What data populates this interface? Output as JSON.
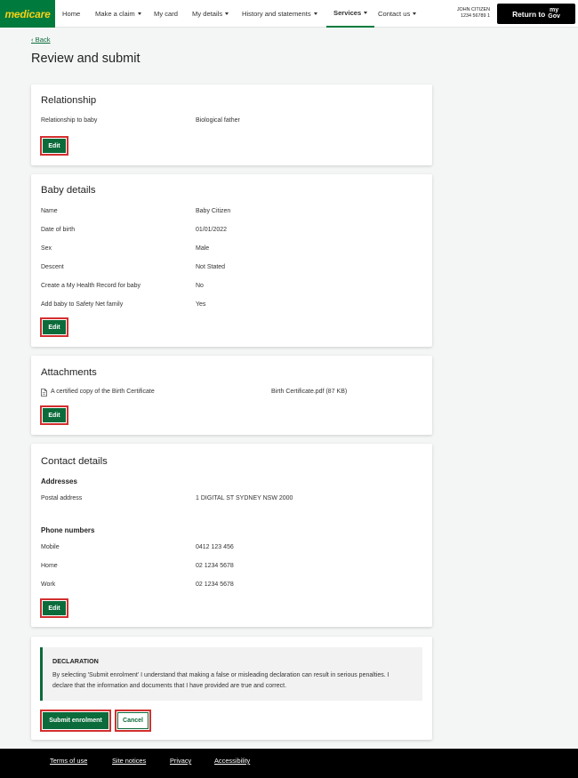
{
  "brand": {
    "logo_text": "medicare",
    "primary_color": "#007a3d",
    "logo_text_color": "#f7d117"
  },
  "nav": {
    "items": [
      {
        "label": "Home",
        "caret": false,
        "active": false
      },
      {
        "label": "Make a claim",
        "caret": true,
        "active": false
      },
      {
        "label": "My card",
        "caret": false,
        "active": false
      },
      {
        "label": "My details",
        "caret": true,
        "active": false
      },
      {
        "label": "History and statements",
        "caret": true,
        "active": false
      },
      {
        "label": "Services",
        "caret": true,
        "active": true
      },
      {
        "label": "Contact us",
        "caret": true,
        "active": false
      }
    ],
    "user_name": "JOHN CITIZEN",
    "user_number": "1234 56789 1",
    "return_label": "Return to",
    "mygov_line1": "my",
    "mygov_line2": "Gov"
  },
  "page": {
    "back_label": "Back",
    "title": "Review and submit"
  },
  "relationship": {
    "title": "Relationship",
    "rows": [
      {
        "label": "Relationship to baby",
        "value": "Biological father"
      }
    ],
    "edit_label": "Edit"
  },
  "baby_details": {
    "title": "Baby details",
    "rows": [
      {
        "label": "Name",
        "value": "Baby Citizen"
      },
      {
        "label": "Date of birth",
        "value": "01/01/2022"
      },
      {
        "label": "Sex",
        "value": "Male"
      },
      {
        "label": "Descent",
        "value": "Not Stated"
      },
      {
        "label": "Create a My Health Record for baby",
        "value": "No"
      },
      {
        "label": "Add baby to Safety Net family",
        "value": "Yes"
      }
    ],
    "edit_label": "Edit"
  },
  "attachments": {
    "title": "Attachments",
    "item_label": "A certified copy of the Birth Certificate",
    "item_value": "Birth Certificate.pdf (87 KB)",
    "edit_label": "Edit"
  },
  "contact_details": {
    "title": "Contact details",
    "addresses_heading": "Addresses",
    "postal_label": "Postal address",
    "postal_value": "1 DIGITAL ST SYDNEY NSW 2000",
    "phones_heading": "Phone numbers",
    "phones": [
      {
        "label": "Mobile",
        "value": "0412 123 456"
      },
      {
        "label": "Home",
        "value": "02 1234 5678"
      },
      {
        "label": "Work",
        "value": "02 1234 5678"
      }
    ],
    "edit_label": "Edit"
  },
  "declaration": {
    "heading": "DECLARATION",
    "text": "By selecting 'Submit enrolment' I understand that making a false or misleading declaration can result in serious penalties. I declare that the information and documents that I have provided are true and correct.",
    "submit_label": "Submit enrolment",
    "cancel_label": "Cancel"
  },
  "footer": {
    "links": [
      "Terms of use",
      "Site notices",
      "Privacy",
      "Accessibility"
    ]
  }
}
